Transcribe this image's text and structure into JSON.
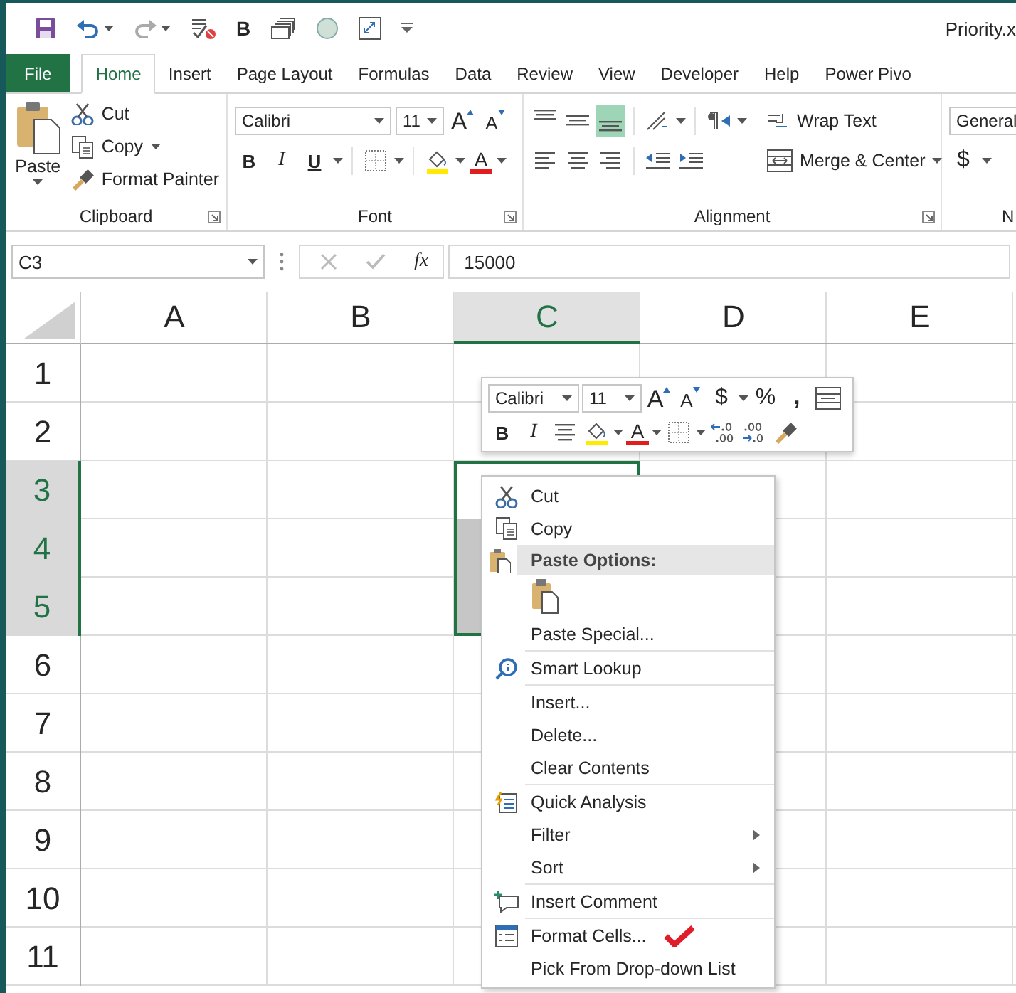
{
  "window": {
    "title": "Priority.x"
  },
  "quick_access": [
    {
      "kind": "save"
    },
    {
      "kind": "undo"
    },
    {
      "kind": "redo"
    },
    {
      "kind": "spelling"
    },
    {
      "kind": "text",
      "label": "B"
    },
    {
      "kind": "form"
    },
    {
      "kind": "circle"
    },
    {
      "kind": "picture"
    },
    {
      "kind": "customize"
    }
  ],
  "tabs": [
    {
      "label": "File",
      "kind": "file",
      "selected": false
    },
    {
      "label": "Home",
      "kind": "tab",
      "selected": true
    },
    {
      "label": "Insert",
      "kind": "tab",
      "selected": false
    },
    {
      "label": "Page Layout",
      "kind": "tab",
      "selected": false
    },
    {
      "label": "Formulas",
      "kind": "tab",
      "selected": false
    },
    {
      "label": "Data",
      "kind": "tab",
      "selected": false
    },
    {
      "label": "Review",
      "kind": "tab",
      "selected": false
    },
    {
      "label": "View",
      "kind": "tab",
      "selected": false
    },
    {
      "label": "Developer",
      "kind": "tab",
      "selected": false
    },
    {
      "label": "Help",
      "kind": "tab",
      "selected": false
    },
    {
      "label": "Power Pivo",
      "kind": "tab",
      "selected": false
    }
  ],
  "ribbon": {
    "clipboard": {
      "title": "Clipboard",
      "paste": "Paste",
      "cut": "Cut",
      "copy": "Copy",
      "format_painter": "Format Painter"
    },
    "font": {
      "title": "Font",
      "font_name": "Calibri",
      "font_size": "11",
      "grow": "A",
      "shrink": "A",
      "bold": "B",
      "italic": "I",
      "underline": "U",
      "font_color": "A"
    },
    "alignment": {
      "title": "Alignment",
      "vertical_align": [
        {
          "selected": false
        },
        {
          "selected": false
        },
        {
          "selected": true
        }
      ],
      "wrap_text": "Wrap Text",
      "merge_center": "Merge & Center"
    },
    "number": {
      "title": "N",
      "format": "General",
      "currency": "$"
    }
  },
  "formula_bar": {
    "name_box": "C3",
    "function_label": "fx",
    "value": "15000"
  },
  "sheet": {
    "columns": [
      {
        "label": "A",
        "selected": false
      },
      {
        "label": "B",
        "selected": false
      },
      {
        "label": "C",
        "selected": true
      },
      {
        "label": "D",
        "selected": false
      },
      {
        "label": "E",
        "selected": false
      }
    ],
    "rows": [
      {
        "label": "1",
        "selected": false
      },
      {
        "label": "2",
        "selected": false
      },
      {
        "label": "3",
        "selected": true
      },
      {
        "label": "4",
        "selected": true
      },
      {
        "label": "5",
        "selected": true
      },
      {
        "label": "6",
        "selected": false
      },
      {
        "label": "7",
        "selected": false
      },
      {
        "label": "8",
        "selected": false
      },
      {
        "label": "9",
        "selected": false
      },
      {
        "label": "10",
        "selected": false
      },
      {
        "label": "11",
        "selected": false
      }
    ]
  },
  "mini_toolbar": {
    "font_name": "Calibri",
    "font_size": "11",
    "grow": "A",
    "shrink": "A",
    "currency": "$",
    "percent": "%",
    "comma": ",",
    "bold": "B",
    "italic": "I",
    "font_color": "A"
  },
  "context_menu": {
    "items": [
      {
        "kind": "cut",
        "label": "Cut",
        "separator": false,
        "marked": false
      },
      {
        "kind": "copy",
        "label": "Copy",
        "separator": false,
        "marked": false
      },
      {
        "kind": "paste_header",
        "label": "Paste Options:",
        "separator": false,
        "marked": false
      },
      {
        "kind": "paste_option",
        "separator": false,
        "marked": false
      },
      {
        "kind": "plain",
        "label": "Paste Special...",
        "separator": false,
        "marked": false
      },
      {
        "kind": "lookup",
        "label": "Smart Lookup",
        "separator": true,
        "marked": false
      },
      {
        "kind": "plain",
        "label": "Insert...",
        "separator": true,
        "marked": false
      },
      {
        "kind": "plain",
        "label": "Delete...",
        "separator": false,
        "marked": false
      },
      {
        "kind": "plain",
        "label": "Clear Contents",
        "separator": false,
        "marked": false
      },
      {
        "kind": "quick_analysis",
        "label": "Quick Analysis",
        "separator": true,
        "marked": false
      },
      {
        "kind": "submenu",
        "label": "Filter",
        "separator": false,
        "marked": false
      },
      {
        "kind": "submenu",
        "label": "Sort",
        "separator": false,
        "marked": false
      },
      {
        "kind": "comment",
        "label": "Insert Comment",
        "separator": true,
        "marked": false
      },
      {
        "kind": "format_cells",
        "label": "Format Cells...",
        "separator": true,
        "marked": true
      },
      {
        "kind": "plain",
        "label": "Pick From Drop-down List",
        "separator": false,
        "marked": false
      }
    ]
  }
}
